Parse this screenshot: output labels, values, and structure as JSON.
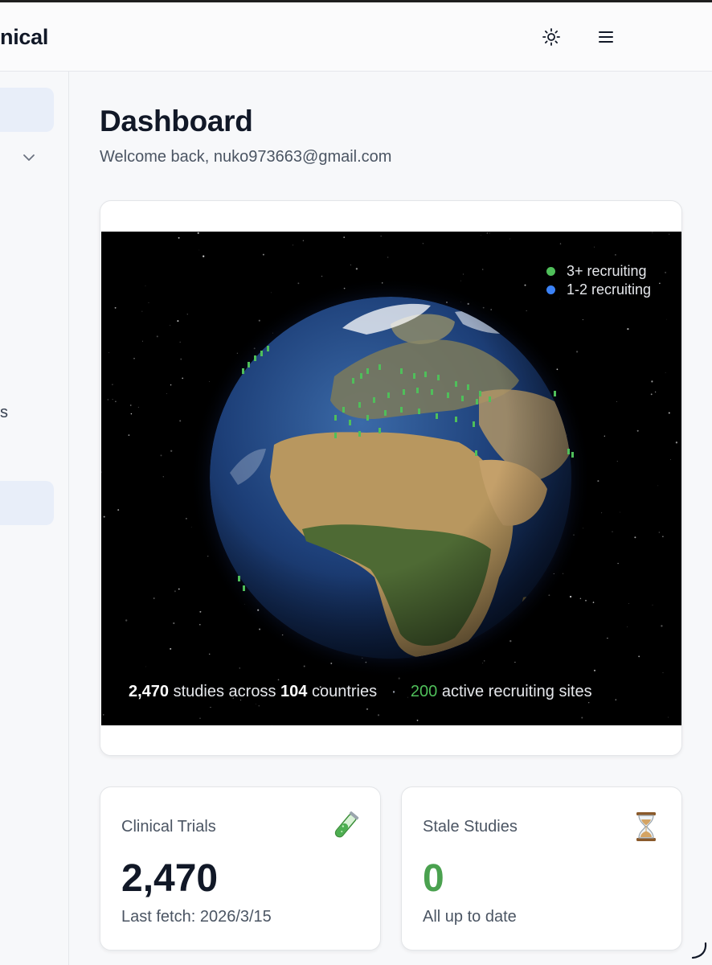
{
  "header": {
    "brand": "nical",
    "theme_icon": "sun-icon",
    "menu_icon": "hamburger-menu-icon"
  },
  "sidebar": {
    "partial_label": "s",
    "chevron_icon": "chevron-down-icon"
  },
  "page": {
    "title": "Dashboard",
    "welcome": "Welcome back, nuko973663@gmail.com"
  },
  "globe": {
    "legend": [
      {
        "label": "3+ recruiting",
        "color": "#4fbf5a"
      },
      {
        "label": "1-2 recruiting",
        "color": "#3b82f6"
      }
    ],
    "stats": {
      "studies": "2,470",
      "studies_text": "studies across",
      "countries": "104",
      "countries_text": "countries",
      "separator": "·",
      "sites": "200",
      "sites_text": "active recruiting sites"
    }
  },
  "cards": {
    "clinical_trials": {
      "title": "Clinical Trials",
      "value": "2,470",
      "subtitle": "Last fetch: 2026/3/15",
      "icon": "test-tube-icon"
    },
    "stale_studies": {
      "title": "Stale Studies",
      "value": "0",
      "subtitle": "All up to date",
      "icon": "hourglass-icon",
      "value_color": "#4aa14f"
    }
  },
  "colors": {
    "accent_green": "#4fbf5a",
    "accent_blue": "#3b82f6",
    "sidebar_active": "#e8eef9"
  }
}
